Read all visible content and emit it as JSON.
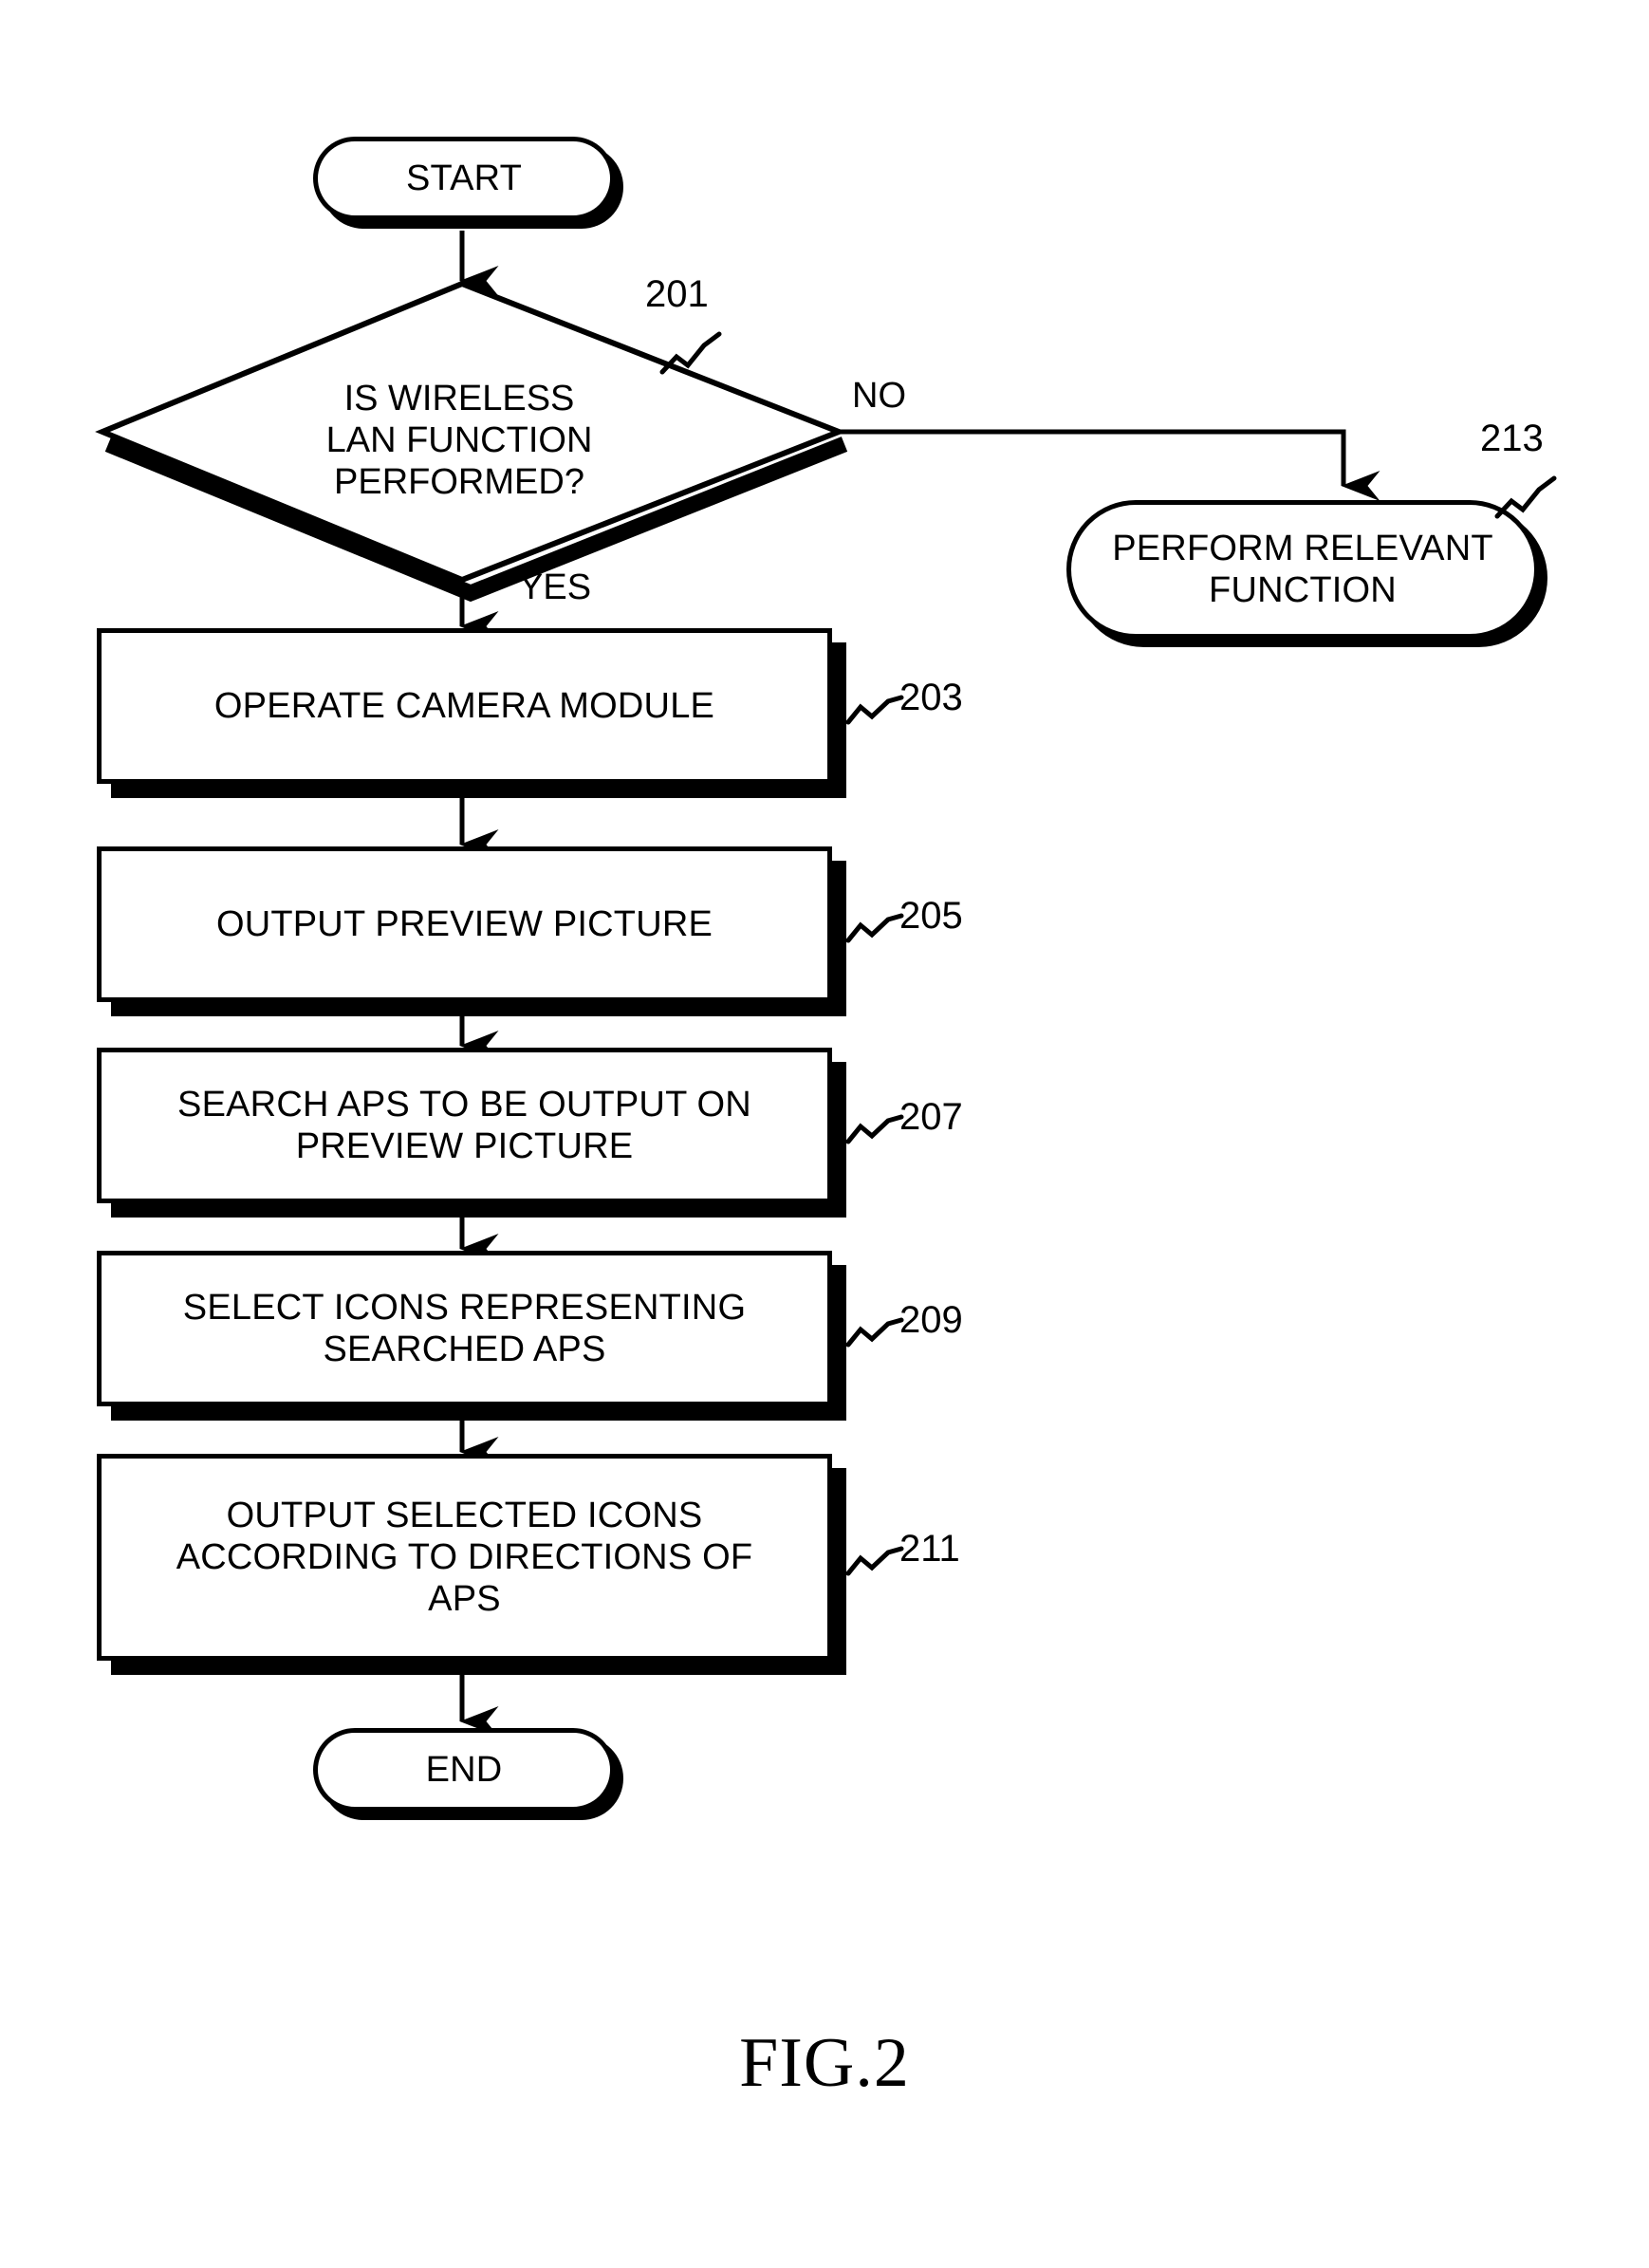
{
  "figure": {
    "caption": "FIG.2",
    "type": "flowchart"
  },
  "nodes": {
    "start": {
      "label": "START",
      "shape": "terminal"
    },
    "decision_201": {
      "label": "IS WIRELESS\nLAN FUNCTION\nPERFORMED?",
      "shape": "decision",
      "ref": "201"
    },
    "perform_relevant_213": {
      "label": "PERFORM RELEVANT\nFUNCTION",
      "shape": "terminal",
      "ref": "213"
    },
    "operate_camera_203": {
      "label": "OPERATE CAMERA MODULE",
      "shape": "process",
      "ref": "203"
    },
    "output_preview_205": {
      "label": "OUTPUT PREVIEW PICTURE",
      "shape": "process",
      "ref": "205"
    },
    "search_aps_207": {
      "label": "SEARCH APS TO BE OUTPUT ON\nPREVIEW PICTURE",
      "shape": "process",
      "ref": "207"
    },
    "select_icons_209": {
      "label": "SELECT ICONS REPRESENTING\nSEARCHED APS",
      "shape": "process",
      "ref": "209"
    },
    "output_icons_211": {
      "label": "OUTPUT SELECTED ICONS\nACCORDING TO DIRECTIONS OF\nAPS",
      "shape": "process",
      "ref": "211"
    },
    "end": {
      "label": "END",
      "shape": "terminal"
    }
  },
  "branch_labels": {
    "no": "NO",
    "yes": "YES"
  },
  "colors": {
    "stroke": "#000000",
    "fill": "#ffffff",
    "shadow": "#000000"
  }
}
